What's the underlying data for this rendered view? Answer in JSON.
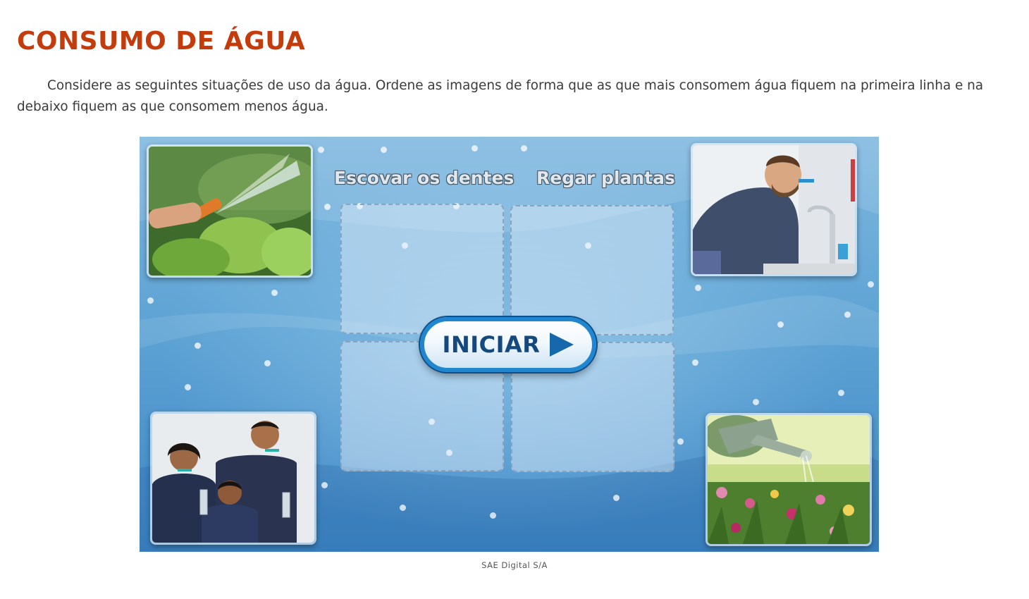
{
  "page": {
    "title": "CONSUMO DE ÁGUA",
    "instructions": "Considere as seguintes situações de uso da água. Ordene as imagens de forma que as que mais consomem água fiquem na primeira linha e na debaixo fiquem as que consomem menos água.",
    "caption": "SAE Digital S/A"
  },
  "game": {
    "column_labels": [
      "Escovar os dentes",
      "Regar plantas"
    ],
    "start_button": {
      "label": "INICIAR",
      "icon": "play-icon"
    },
    "cards": [
      {
        "name": "garden-hose-photo"
      },
      {
        "name": "man-brushing-teeth-photo"
      },
      {
        "name": "family-brushing-teeth-photo"
      },
      {
        "name": "watering-can-photo"
      }
    ]
  },
  "colors": {
    "title": "#c43c0c",
    "text": "#3b3b3b",
    "game_bg": "#5ea3d4",
    "button_border": "#1f86cf",
    "button_text": "#14497e"
  }
}
